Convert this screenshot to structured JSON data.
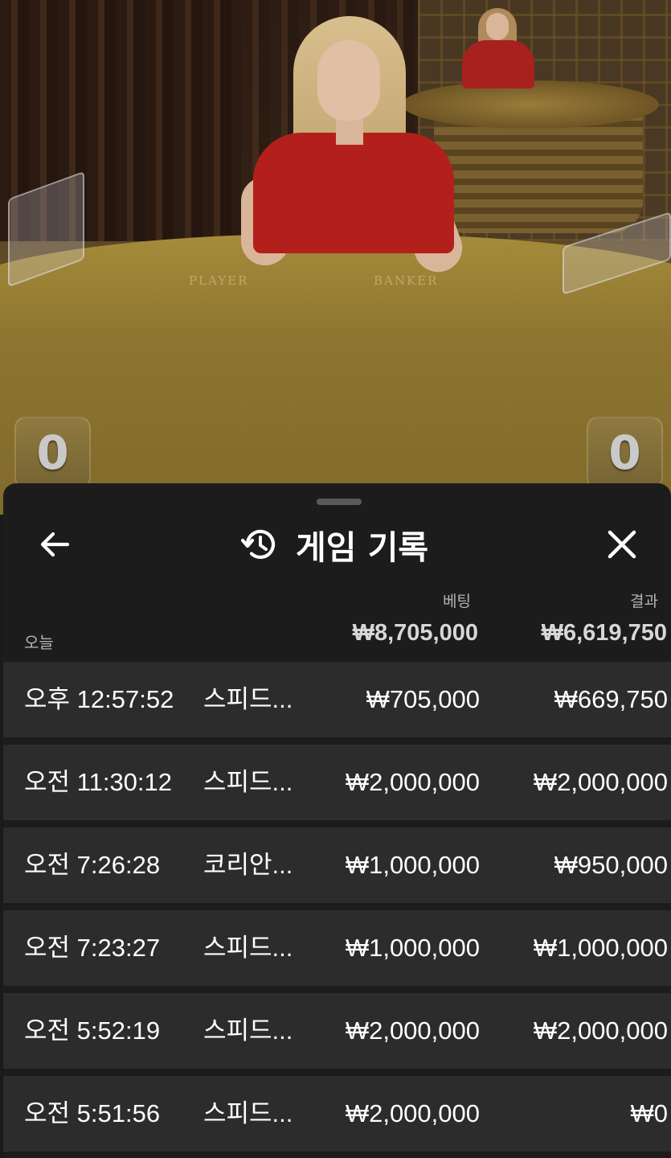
{
  "video": {
    "table_labels": {
      "player": "PLAYER",
      "banker": "BANKER"
    },
    "scores": {
      "left": "0",
      "right": "0"
    }
  },
  "header": {
    "title": "게임 기록",
    "back_icon": "arrow-left-icon",
    "history_icon": "history-clock-icon",
    "close_icon": "close-x-icon"
  },
  "columns": {
    "bet": "베팅",
    "result": "결과"
  },
  "summary": {
    "period": "오늘",
    "total_bet": "₩8,705,000",
    "total_result": "₩6,619,750"
  },
  "rows": [
    {
      "time": "오후 12:57:52",
      "game": "스피드...",
      "bet": "₩705,000",
      "result": "₩669,750"
    },
    {
      "time": "오전 11:30:12",
      "game": "스피드...",
      "bet": "₩2,000,000",
      "result": "₩2,000,000"
    },
    {
      "time": "오전 7:26:28",
      "game": "코리안...",
      "bet": "₩1,000,000",
      "result": "₩950,000"
    },
    {
      "time": "오전 7:23:27",
      "game": "스피드...",
      "bet": "₩1,000,000",
      "result": "₩1,000,000"
    },
    {
      "time": "오전 5:52:19",
      "game": "스피드...",
      "bet": "₩2,000,000",
      "result": "₩2,000,000"
    },
    {
      "time": "오전 5:51:56",
      "game": "스피드...",
      "bet": "₩2,000,000",
      "result": "₩0"
    }
  ]
}
